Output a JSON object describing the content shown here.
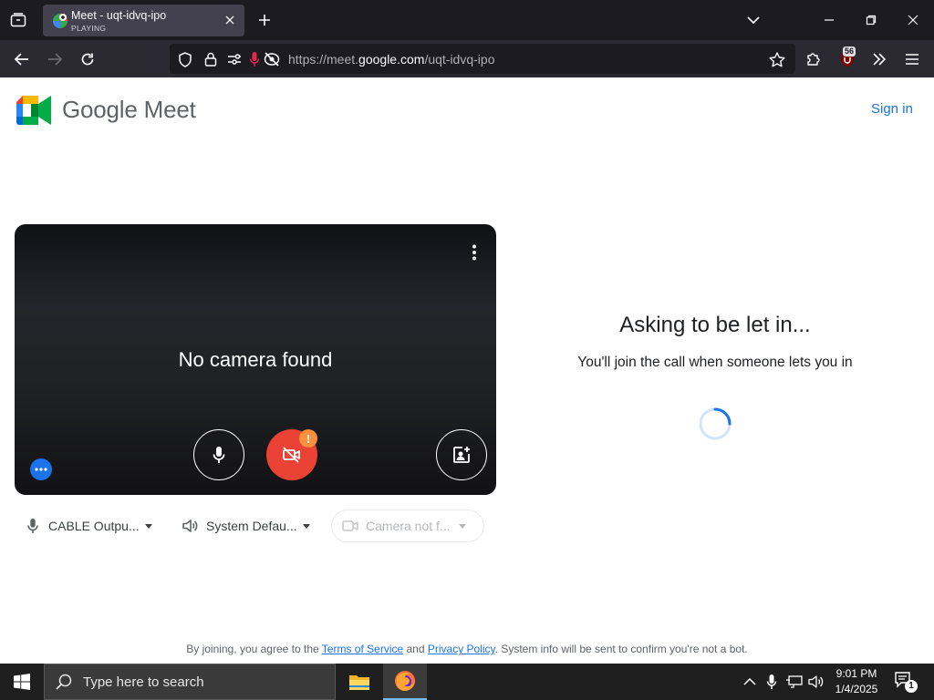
{
  "browser": {
    "tab": {
      "title": "Meet - uqt-idvq-ipo",
      "status": "PLAYING"
    },
    "url": {
      "prefix": "https://meet.",
      "domain": "google.com",
      "path": "/uqt-idvq-ipo"
    },
    "extension_badge": "56"
  },
  "header": {
    "brand": "Google Meet",
    "signin": "Sign in"
  },
  "video": {
    "message": "No camera found",
    "warning_glyph": "!"
  },
  "devices": {
    "mic": "CABLE Outpu...",
    "speaker": "System Defau...",
    "camera": "Camera not f..."
  },
  "status": {
    "title": "Asking to be let in...",
    "subtitle": "You'll join the call when someone lets you in"
  },
  "footer": {
    "prefix": "By joining, you agree to the ",
    "terms": "Terms of Service",
    "and": " and ",
    "privacy": "Privacy Policy",
    "suffix": ". System info will be sent to confirm you're not a bot."
  },
  "taskbar": {
    "search_placeholder": "Type here to search",
    "time": "9:01 PM",
    "date": "1/4/2025",
    "notification_count": "1"
  },
  "colors": {
    "accent": "#1a73e8",
    "camera_off": "#ea4335",
    "warning": "#fa903e",
    "browser_bg": "#1c1b22"
  }
}
